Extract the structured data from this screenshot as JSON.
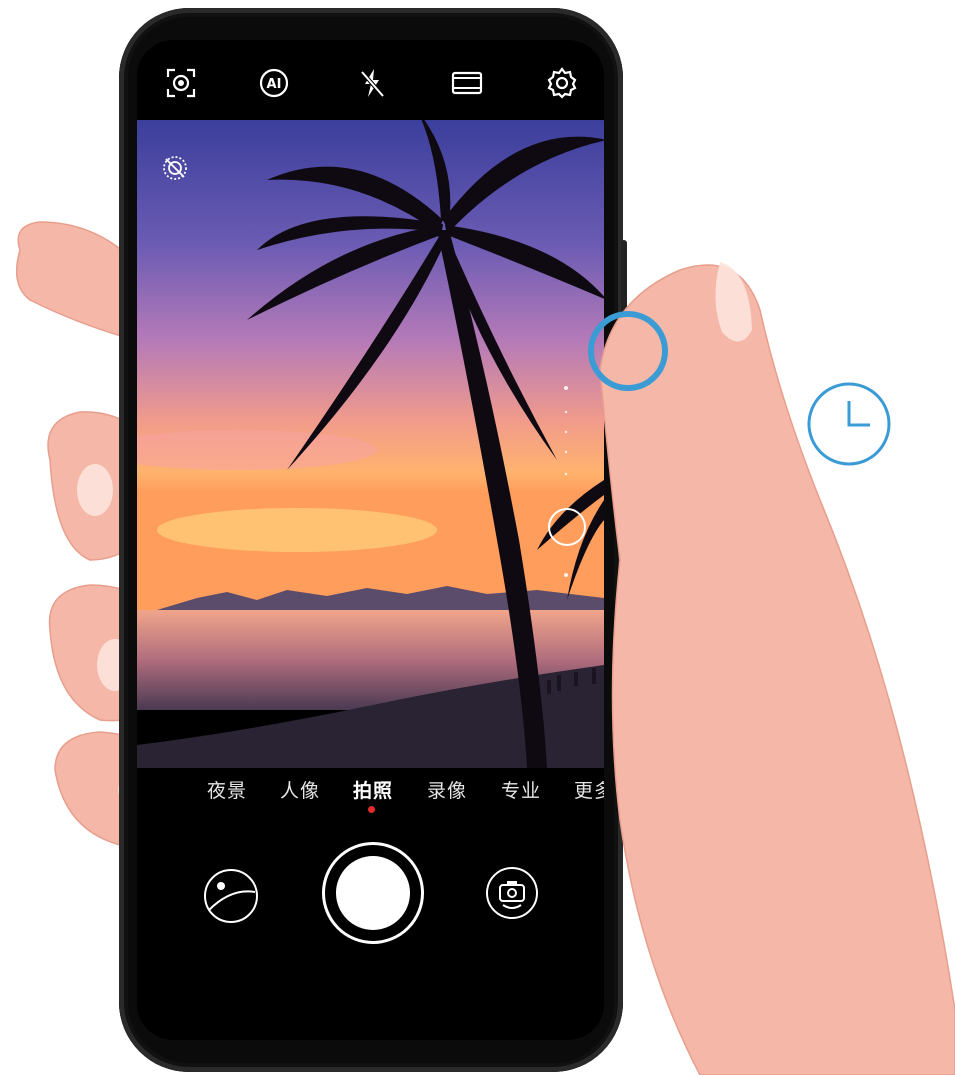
{
  "camera": {
    "top_icons": [
      "lens-focus-icon",
      "ai-mode-icon",
      "flash-off-icon",
      "aspect-ratio-icon",
      "gear-icon"
    ],
    "viewfinder_icons": [
      "beauty-off-icon",
      "focus-ring-icon"
    ],
    "modes": [
      {
        "label": "夜景",
        "active": false
      },
      {
        "label": "人像",
        "active": false
      },
      {
        "label": "拍照",
        "active": true
      },
      {
        "label": "录像",
        "active": false
      },
      {
        "label": "专业",
        "active": false
      },
      {
        "label": "更多",
        "active": false
      }
    ],
    "bottom_controls": [
      "gallery-thumbnail-icon",
      "shutter-button",
      "switch-camera-icon"
    ],
    "colors": {
      "accent": "#3a9bd5",
      "active_mode_dot": "#e32b2b"
    }
  },
  "illustration": {
    "highlight": "volume-button-highlight",
    "timer_icon": "clock-icon"
  }
}
